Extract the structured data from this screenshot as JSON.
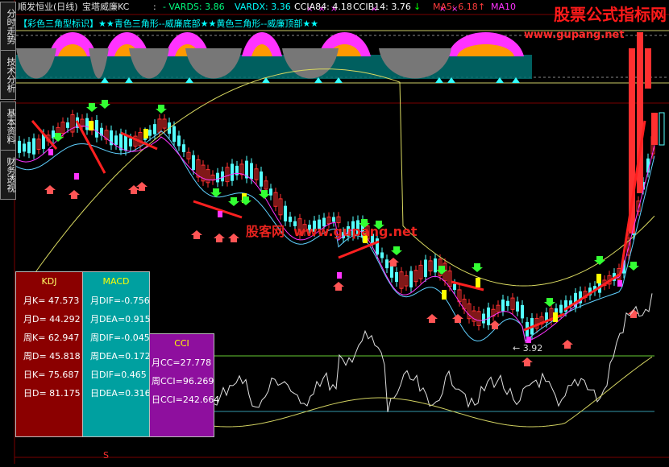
{
  "header": {
    "stock": "顺发恒业(日线)",
    "indicator": "宝塔威廉KC",
    "sep": ":",
    "vards": "- VARDS: 3.86",
    "vardx": "VARDX: 3.36",
    "ccia84": "CCIA84: 4.18",
    "ccib14": "CCIB14: 3.76",
    "ma5": "MA5: 6.18",
    "ma10": "MA10"
  },
  "banner": "【彩色三角型标识】★★青色三角形--威廉底部★★黄色三角形--威廉顶部★★",
  "watermark": {
    "title": "股票公式指标网",
    "url": "www.gupang.net",
    "mid_cn": "股客网",
    "mid_url": "www.gupang.net"
  },
  "side_tabs": [
    "分时走势",
    "技术分析",
    "基本资料",
    "财务透视"
  ],
  "low_label": "3.92",
  "bottom_marker": "S",
  "kdj": {
    "title": "KDJ",
    "rows": [
      "月K= 47.573",
      "月D= 44.292",
      "周K= 62.947",
      "周D= 45.818",
      "日K= 75.687",
      "日D= 81.175"
    ]
  },
  "macd": {
    "title": "MACD",
    "rows": [
      "月DIF=-0.756",
      "月DEA=0.915",
      "周DIF=-0.045",
      "周DEA=0.172",
      "日DIF=0.465",
      "日DEA=0.316"
    ]
  },
  "cci": {
    "title": "CCI",
    "rows": [
      "月CC=27.778",
      "周CCI=96.269",
      "日CCI=242.664"
    ]
  },
  "colors": {
    "up": "#ff3030",
    "down": "#54ffff",
    "magenta": "#ff33ff",
    "yellow": "#ffff00",
    "orange": "#ff9900",
    "teal": "#007070",
    "kdj_bg": "#8b0000",
    "macd_bg": "#00a0a0",
    "cci_bg": "#8e0f9e"
  }
}
